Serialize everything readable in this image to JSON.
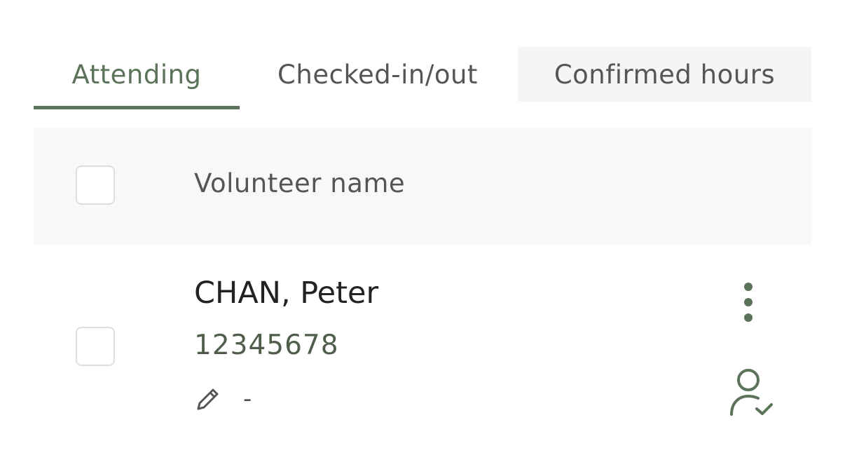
{
  "tabs": [
    {
      "label": "Attending",
      "active": true
    },
    {
      "label": "Checked-in/out",
      "active": false
    },
    {
      "label": "Confirmed hours",
      "active": false
    }
  ],
  "table": {
    "header": {
      "column_label": "Volunteer name"
    },
    "rows": [
      {
        "name": "CHAN, Peter",
        "id": "12345678",
        "note": "-",
        "actions": [
          "more-options-icon",
          "person-check-icon"
        ]
      }
    ]
  },
  "colors": {
    "accent": "#5b7358",
    "id_text": "#4f5e4b",
    "header_bg": "#f8f8f8",
    "inactive_tab_bg": "#f5f5f5",
    "text_primary": "#222222",
    "text_secondary": "#555555",
    "checkbox_border": "#dedede"
  }
}
